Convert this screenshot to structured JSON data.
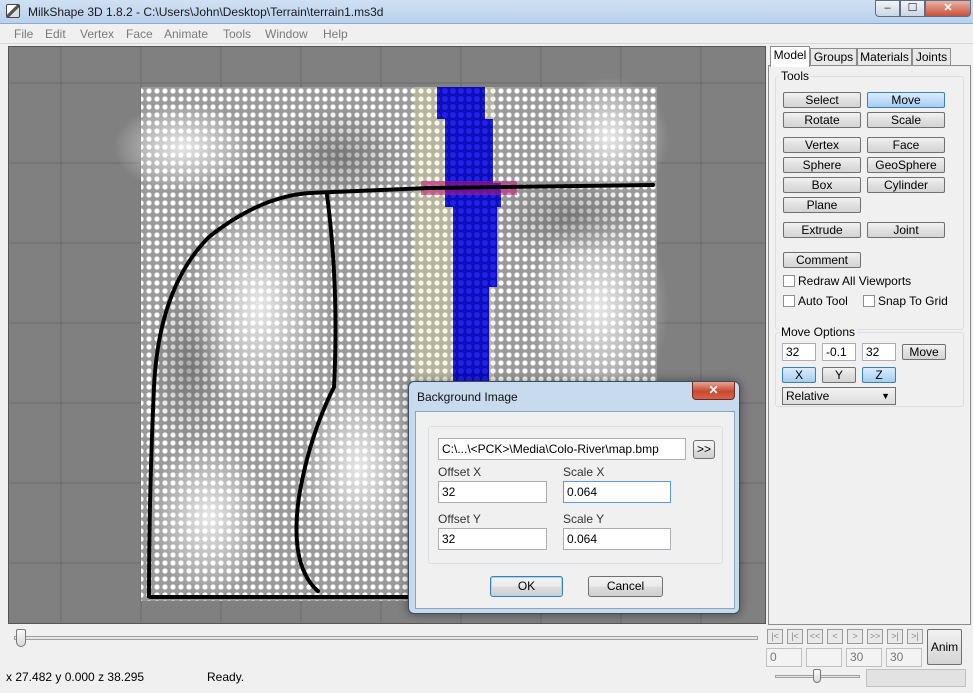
{
  "window": {
    "title": "MilkShape 3D 1.8.2 - C:\\Users\\John\\Desktop\\Terrain\\terrain1.ms3d",
    "minimize_label": "–",
    "maximize_label": "☐",
    "close_label": "✕"
  },
  "menu": [
    "File",
    "Edit",
    "Vertex",
    "Face",
    "Animate",
    "Tools",
    "Window",
    "Help"
  ],
  "panel": {
    "tabs": [
      "Model",
      "Groups",
      "Materials",
      "Joints"
    ],
    "tools_label": "Tools",
    "tools": {
      "select": "Select",
      "move": "Move",
      "rotate": "Rotate",
      "scale": "Scale",
      "vertex": "Vertex",
      "face": "Face",
      "sphere": "Sphere",
      "geosphere": "GeoSphere",
      "box": "Box",
      "cylinder": "Cylinder",
      "plane": "Plane",
      "extrude": "Extrude",
      "joint": "Joint",
      "comment": "Comment"
    },
    "redraw_all": "Redraw All Viewports",
    "auto_tool": "Auto Tool",
    "snap_to_grid": "Snap To Grid",
    "move_options_label": "Move Options",
    "move_x": "32",
    "move_y": "-0.1",
    "move_z": "32",
    "move_button": "Move",
    "axis_x": "X",
    "axis_y": "Y",
    "axis_z": "Z",
    "relative": "Relative"
  },
  "dialog": {
    "title": "Background Image",
    "close_label": "✕",
    "path": "C:\\...\\<PCK>\\Media\\Colo-River\\map.bmp",
    "browse_label": ">>",
    "offset_x_label": "Offset X",
    "offset_x": "32",
    "scale_x_label": "Scale X",
    "scale_x": "0.064",
    "offset_y_label": "Offset Y",
    "offset_y": "32",
    "scale_y_label": "Scale Y",
    "scale_y": "0.064",
    "ok": "OK",
    "cancel": "Cancel"
  },
  "animation": {
    "nav": [
      "|<",
      "|<",
      "<<",
      "<",
      ">",
      ">>",
      ">|",
      ">|"
    ],
    "frame_current": "0",
    "frame_a": "30",
    "frame_b": "30",
    "anim_label": "Anim"
  },
  "status": {
    "coords": "x 27.482 y 0.000 z 38.295",
    "text": "Ready."
  },
  "colors": {
    "selected_faces": "#1010d0",
    "viewport_bg": "#808080",
    "grid_lines": "#6a6a6a",
    "highlight_strip": "#c0187a"
  }
}
